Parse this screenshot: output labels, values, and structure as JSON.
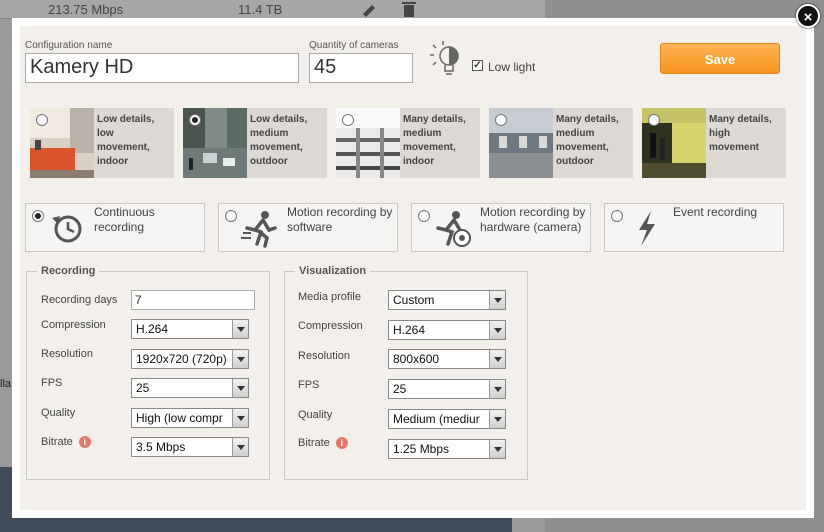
{
  "background": {
    "bandwidth": "213.75 Mbps",
    "storage": "11.4 TB",
    "left_fragment": "lla"
  },
  "config": {
    "name_label": "Configuration name",
    "name_value": "Kamery HD",
    "quantity_label": "Quantity of cameras",
    "quantity_value": "45",
    "low_light_label": "Low light",
    "low_light_checked": true,
    "save_label": "Save"
  },
  "presets": [
    {
      "label": "Low details, low movement, indoor",
      "selected": false
    },
    {
      "label": "Low details, medium movement, outdoor",
      "selected": true
    },
    {
      "label": "Many details, medium movement, indoor",
      "selected": false
    },
    {
      "label": "Many details, medium movement, outdoor",
      "selected": false
    },
    {
      "label": "Many details, high movement",
      "selected": false
    }
  ],
  "modes": [
    {
      "label": "Continuous recording",
      "icon": "clock-arrow-icon",
      "selected": true
    },
    {
      "label": "Motion recording by software",
      "icon": "running-man-icon",
      "selected": false
    },
    {
      "label": "Motion recording by hardware (camera)",
      "icon": "running-man-camera-icon",
      "selected": false
    },
    {
      "label": "Event recording",
      "icon": "lightning-icon",
      "selected": false
    }
  ],
  "recording": {
    "title": "Recording",
    "days_label": "Recording days",
    "days_value": "7",
    "compression_label": "Compression",
    "compression_value": "H.264",
    "resolution_label": "Resolution",
    "resolution_value": "1920x720 (720p)",
    "fps_label": "FPS",
    "fps_value": "25",
    "quality_label": "Quality",
    "quality_value": "High (low compr",
    "bitrate_label": "Bitrate",
    "bitrate_value": "3.5 Mbps"
  },
  "visualization": {
    "title": "Visualization",
    "profile_label": "Media profile",
    "profile_value": "Custom",
    "compression_label": "Compression",
    "compression_value": "H.264",
    "resolution_label": "Resolution",
    "resolution_value": "800x600",
    "fps_label": "FPS",
    "fps_value": "25",
    "quality_label": "Quality",
    "quality_value": "Medium (mediur",
    "bitrate_label": "Bitrate",
    "bitrate_value": "1.25 Mbps"
  },
  "colors": {
    "accent": "#f7941d",
    "panel": "#f3f0ec"
  }
}
